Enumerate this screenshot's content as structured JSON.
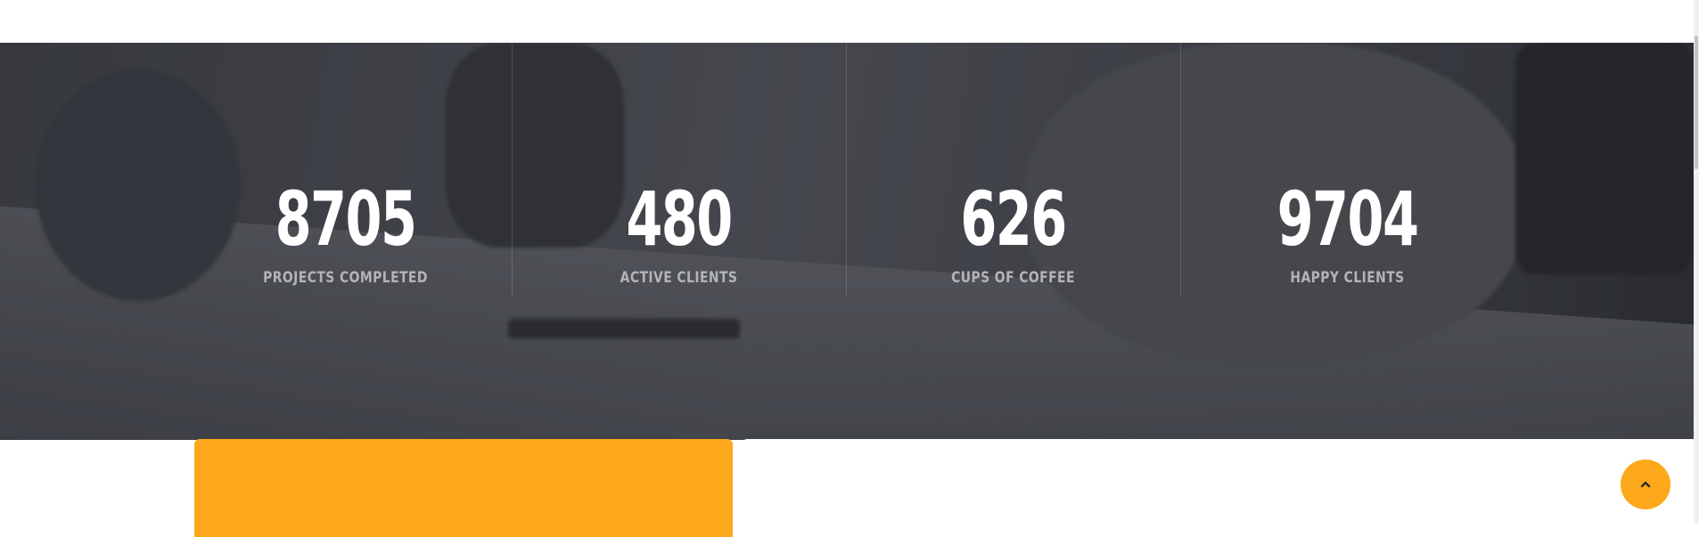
{
  "stats": [
    {
      "value": "8705",
      "label": "PROJECTS COMPLETED"
    },
    {
      "value": "480",
      "label": "ACTIVE CLIENTS"
    },
    {
      "value": "626",
      "label": "CUPS OF COFFEE"
    },
    {
      "value": "9704",
      "label": "HAPPY CLIENTS"
    }
  ],
  "colors": {
    "accent": "#fea81b",
    "stat_number": "#ffffff",
    "stat_label": "#b3b4b8"
  },
  "icons": {
    "back_to_top": "chevron-up-icon"
  }
}
